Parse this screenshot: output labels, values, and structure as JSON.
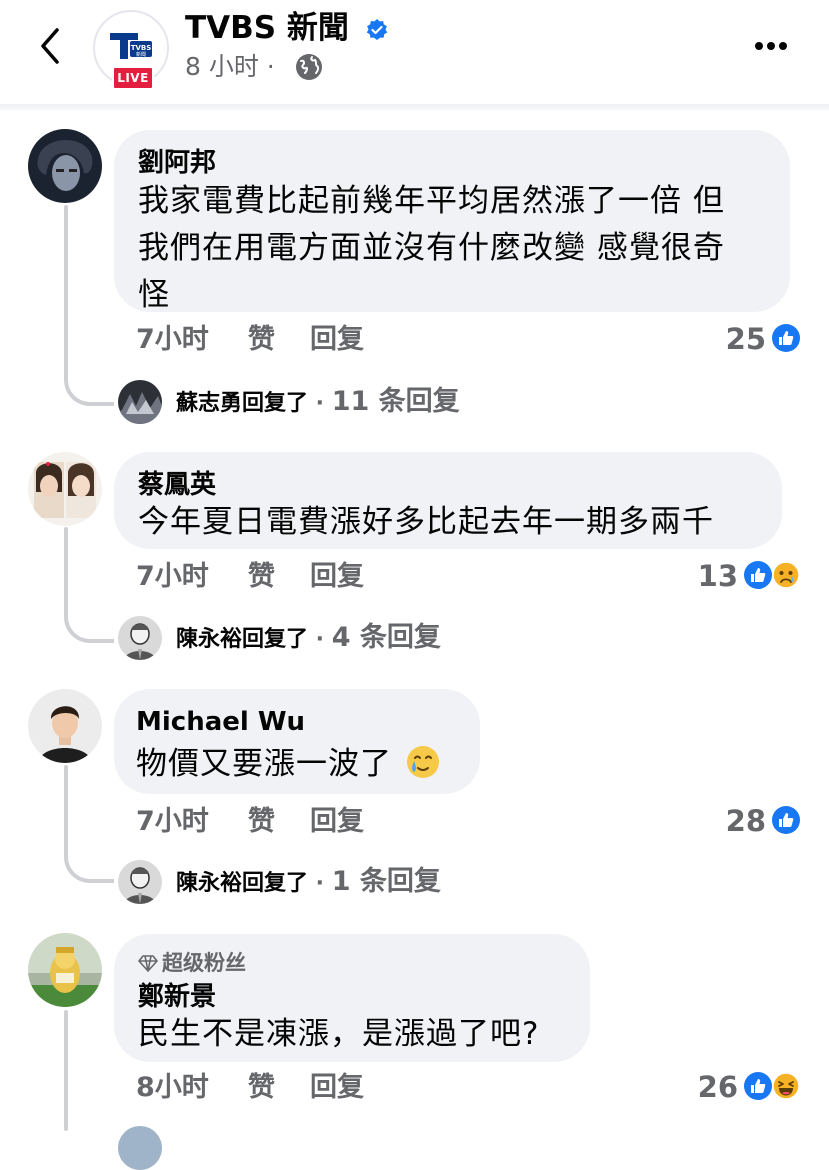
{
  "header": {
    "page_name": "TVBS 新聞",
    "avatar_logo_text": "TVBS 新聞",
    "live_badge": "LIVE",
    "time": "8 小时 ·"
  },
  "comments": [
    {
      "author": "劉阿邦",
      "lines": [
        "我家電費比起前幾年平均居然漲了一倍 但",
        "我們在用電方面並沒有什麼改變 感覺很奇",
        "怪"
      ],
      "time": "7小时",
      "like_label": "赞",
      "reply_label": "回复",
      "reaction_count": "25",
      "reactions": [
        "like"
      ],
      "reply_summary": {
        "who": "蘇志勇回复了",
        "count": "11 条回复"
      }
    },
    {
      "author": "蔡鳳英",
      "lines": [
        "今年夏日電費漲好多比起去年一期多兩千"
      ],
      "time": "7小时",
      "like_label": "赞",
      "reply_label": "回复",
      "reaction_count": "13",
      "reactions": [
        "like",
        "sad"
      ],
      "reply_summary": {
        "who": "陳永裕回复了",
        "count": "4 条回复"
      }
    },
    {
      "author": "Michael Wu",
      "lines": [
        "物價又要漲一波了"
      ],
      "time": "7小时",
      "like_label": "赞",
      "reply_label": "回复",
      "reaction_count": "28",
      "reactions": [
        "like"
      ],
      "reply_summary": {
        "who": "陳永裕回复了",
        "count": "1 条回复"
      }
    },
    {
      "badge": "超级粉丝",
      "author": "鄭新景",
      "lines": [
        "民生不是凍漲，是漲過了吧?"
      ],
      "time": "8小时",
      "like_label": "赞",
      "reply_label": "回复",
      "reaction_count": "26",
      "reactions": [
        "like",
        "haha"
      ]
    }
  ],
  "colors": {
    "like_blue": "#1877f2",
    "secondary_text": "#65676b",
    "bubble_bg": "#f0f2f5",
    "live_red": "#e41e3f"
  },
  "icons": [
    "back-arrow-icon",
    "verified-badge-icon",
    "globe-icon",
    "more-icon",
    "like-reaction-icon",
    "sad-reaction-icon",
    "haha-reaction-icon",
    "crying-smile-emoji-icon",
    "diamond-icon"
  ]
}
